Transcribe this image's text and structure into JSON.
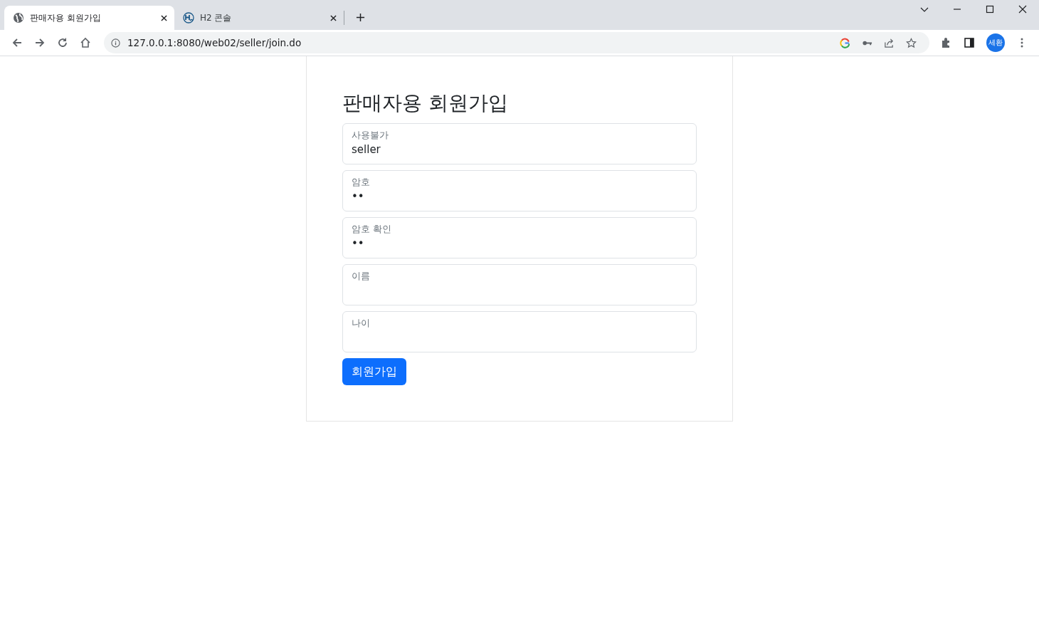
{
  "tabs": [
    {
      "title": "판매자용 회원가입",
      "kind": "globe",
      "selected": true
    },
    {
      "title": "H2 콘솔",
      "kind": "h2",
      "selected": false
    }
  ],
  "address_bar": {
    "url": "127.0.0.1:8080/web02/seller/join.do"
  },
  "profile": {
    "initials": "세환"
  },
  "page": {
    "heading": "판매자용 회원가입",
    "fields": [
      {
        "label": "사용불가",
        "value": "seller"
      },
      {
        "label": "암호",
        "value": "••"
      },
      {
        "label": "암호 확인",
        "value": "••"
      },
      {
        "label": "이름"
      },
      {
        "label": "나이"
      }
    ],
    "submit_button": "회원가입"
  }
}
